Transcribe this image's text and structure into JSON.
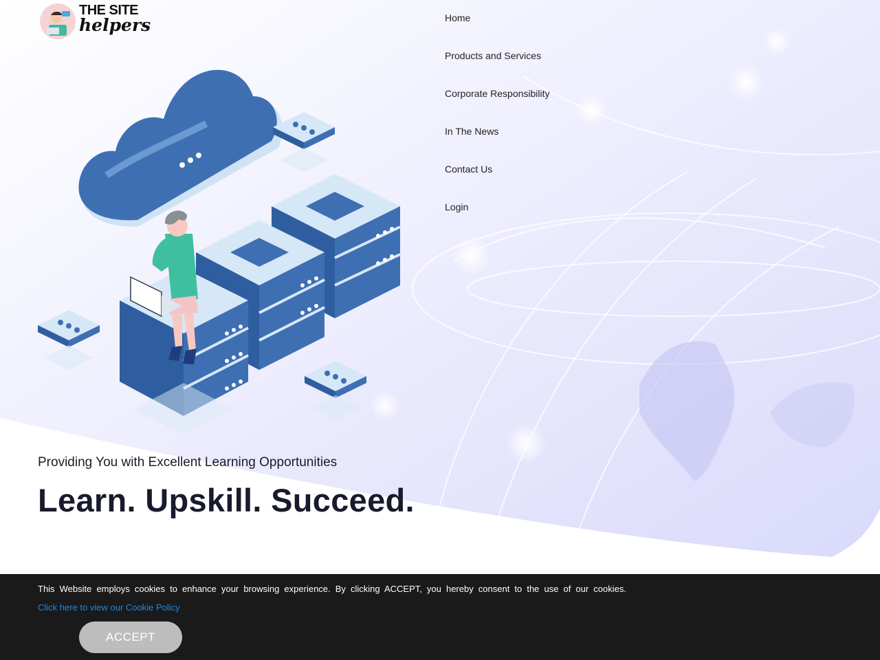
{
  "brand": {
    "line1": "THE SITE",
    "line2": "helpers"
  },
  "nav": {
    "items": [
      {
        "label": "Home"
      },
      {
        "label": "Products and Services"
      },
      {
        "label": "Corporate Responsibility"
      },
      {
        "label": "In The News"
      },
      {
        "label": "Contact Us"
      },
      {
        "label": "Login"
      }
    ]
  },
  "hero": {
    "tagline": "Providing You with Excellent Learning Opportunities",
    "headline": "Learn. Upskill. Succeed."
  },
  "cookie": {
    "message": "This Website employs cookies to enhance your browsing experience. By clicking ACCEPT, you hereby consent to the use of our cookies.",
    "policy_link": "Click here to view our Cookie Policy",
    "accept_label": "ACCEPT"
  },
  "colors": {
    "cookie_bg": "#1a1a1a",
    "link": "#1e88e5",
    "accept_bg": "#bdbdbd",
    "server_blue": "#3e6fb5",
    "server_light": "#d6e8f7"
  }
}
